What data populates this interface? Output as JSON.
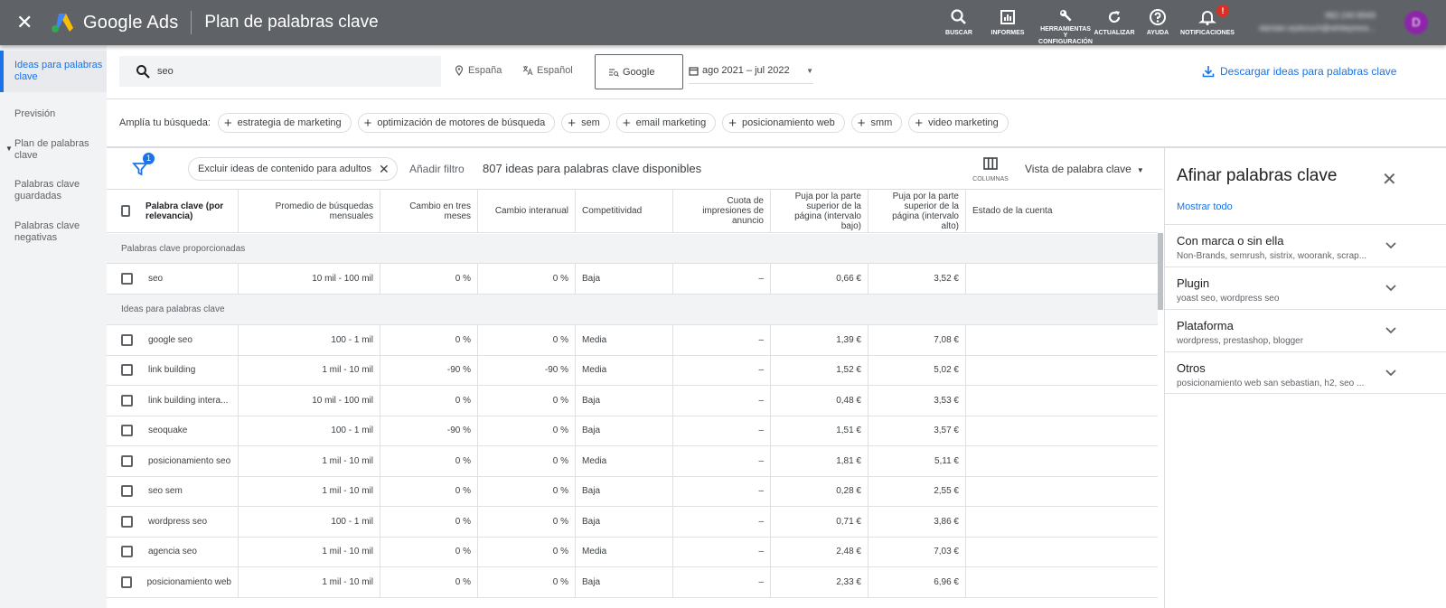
{
  "app": {
    "close_glyph": "✕",
    "brand": "Google Ads",
    "page_title": "Plan de palabras clave",
    "tools": [
      {
        "icon": "search-icon",
        "label": "BUSCAR"
      },
      {
        "icon": "reports-icon",
        "label": "INFORMES"
      },
      {
        "icon": "wrench-icon",
        "label": "HERRAMIENTAS Y CONFIGURACIÓN"
      },
      {
        "icon": "refresh-icon",
        "label": "ACTUALIZAR"
      },
      {
        "icon": "help-icon",
        "label": "AYUDA"
      },
      {
        "icon": "bell-icon",
        "label": "NOTIFICACIONES"
      }
    ],
    "notification_badge": "!",
    "account_line1": "982-240-8949",
    "account_line2": "damian.wylezuch@whitepress...",
    "avatar_letter": "D"
  },
  "sidebar": {
    "items": [
      {
        "label": "Ideas para palabras clave",
        "active": true
      },
      {
        "label": "Previsión",
        "active": false
      },
      {
        "label": "Plan de palabras clave",
        "active": false
      },
      {
        "label": "Palabras clave guardadas",
        "active": false
      },
      {
        "label": "Palabras clave negativas",
        "active": false
      }
    ]
  },
  "search": {
    "value": "seo",
    "location": "España",
    "language": "Español",
    "network": "Google",
    "date_range": "ago 2021 – jul 2022",
    "download_label": "Descargar ideas para palabras clave"
  },
  "broaden": {
    "label": "Amplía tu búsqueda:",
    "chips": [
      "estrategia de marketing",
      "optimización de motores de búsqueda",
      "sem",
      "email marketing",
      "posicionamiento web",
      "smm",
      "video marketing"
    ]
  },
  "filterbar": {
    "filter_count": "1",
    "exclude_chip": "Excluir ideas de contenido para adultos",
    "add_filter": "Añadir filtro",
    "idea_count": "807 ideas para palabras clave disponibles",
    "columns_label": "COLUMNAS",
    "view_label": "Vista de palabra clave"
  },
  "table": {
    "headers": {
      "keyword": "Palabra clave (por relevancia)",
      "avg": "Promedio de búsquedas mensuales",
      "three_month": "Cambio en tres meses",
      "yoy": "Cambio interanual",
      "competition": "Competitividad",
      "impr_share": "Cuota de impresiones de anuncio",
      "bid_low": "Puja por la parte superior de la página (intervalo bajo)",
      "bid_high": "Puja por la parte superior de la página (intervalo alto)",
      "status": "Estado de la cuenta"
    },
    "group1": "Palabras clave proporcionadas",
    "group2": "Ideas para palabras clave",
    "provided": [
      {
        "keyword": "seo",
        "avg": "10 mil - 100 mil",
        "three_month": "0 %",
        "yoy": "0 %",
        "competition": "Baja",
        "impr_share": "–",
        "bid_low": "0,66 €",
        "bid_high": "3,52 €",
        "status": ""
      }
    ],
    "ideas": [
      {
        "keyword": "google seo",
        "avg": "100 - 1 mil",
        "three_month": "0 %",
        "yoy": "0 %",
        "competition": "Media",
        "impr_share": "–",
        "bid_low": "1,39 €",
        "bid_high": "7,08 €",
        "status": ""
      },
      {
        "keyword": "link building",
        "avg": "1 mil - 10 mil",
        "three_month": "-90 %",
        "yoy": "-90 %",
        "competition": "Media",
        "impr_share": "–",
        "bid_low": "1,52 €",
        "bid_high": "5,02 €",
        "status": ""
      },
      {
        "keyword": "link building intera...",
        "avg": "10 mil - 100 mil",
        "three_month": "0 %",
        "yoy": "0 %",
        "competition": "Baja",
        "impr_share": "–",
        "bid_low": "0,48 €",
        "bid_high": "3,53 €",
        "status": ""
      },
      {
        "keyword": "seoquake",
        "avg": "100 - 1 mil",
        "three_month": "-90 %",
        "yoy": "0 %",
        "competition": "Baja",
        "impr_share": "–",
        "bid_low": "1,51 €",
        "bid_high": "3,57 €",
        "status": ""
      },
      {
        "keyword": "posicionamiento seo",
        "avg": "1 mil - 10 mil",
        "three_month": "0 %",
        "yoy": "0 %",
        "competition": "Media",
        "impr_share": "–",
        "bid_low": "1,81 €",
        "bid_high": "5,11 €",
        "status": ""
      },
      {
        "keyword": "seo sem",
        "avg": "1 mil - 10 mil",
        "three_month": "0 %",
        "yoy": "0 %",
        "competition": "Baja",
        "impr_share": "–",
        "bid_low": "0,28 €",
        "bid_high": "2,55 €",
        "status": ""
      },
      {
        "keyword": "wordpress seo",
        "avg": "100 - 1 mil",
        "three_month": "0 %",
        "yoy": "0 %",
        "competition": "Baja",
        "impr_share": "–",
        "bid_low": "0,71 €",
        "bid_high": "3,86 €",
        "status": ""
      },
      {
        "keyword": "agencia seo",
        "avg": "1 mil - 10 mil",
        "three_month": "0 %",
        "yoy": "0 %",
        "competition": "Media",
        "impr_share": "–",
        "bid_low": "2,48 €",
        "bid_high": "7,03 €",
        "status": ""
      },
      {
        "keyword": "posicionamiento web",
        "avg": "1 mil - 10 mil",
        "three_month": "0 %",
        "yoy": "0 %",
        "competition": "Baja",
        "impr_share": "–",
        "bid_low": "2,33 €",
        "bid_high": "6,96 €",
        "status": ""
      }
    ]
  },
  "refine": {
    "title": "Afinar palabras clave",
    "show_all": "Mostrar todo",
    "groups": [
      {
        "title": "Con marca o sin ella",
        "sub": "Non-Brands, semrush, sistrix, woorank, scrap..."
      },
      {
        "title": "Plugin",
        "sub": "yoast seo, wordpress seo"
      },
      {
        "title": "Plataforma",
        "sub": "wordpress, prestashop, blogger"
      },
      {
        "title": "Otros",
        "sub": "posicionamiento web san sebastian, h2, seo ..."
      }
    ]
  },
  "colors": {
    "topbar": "#5f6368",
    "accent": "#1a73e8",
    "badge": "#d93025"
  }
}
